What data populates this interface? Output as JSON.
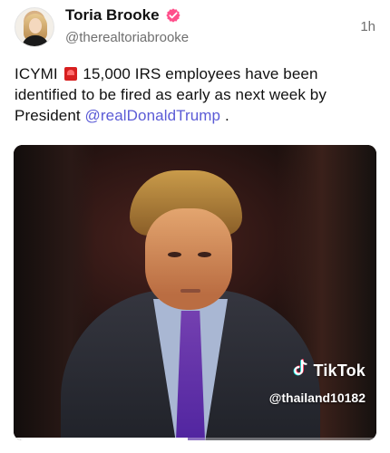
{
  "post": {
    "author_name": "Toria Brooke",
    "handle": "@therealtoriabrooke",
    "time": "1h",
    "text_before_siren": "ICYMI",
    "text_after_siren": "15,000 IRS employees have been identified to be fired as early as next week by President",
    "mention": "@realDonaldTrump",
    "text_end": "."
  },
  "media": {
    "watermark_brand": "TikTok",
    "watermark_handle": "@thailand10182",
    "playback_progress": 0.48
  },
  "icons": {
    "verified": "verified-badge-icon",
    "siren": "police-siren-emoji",
    "tiktok": "tiktok-logo-icon"
  },
  "colors": {
    "verified_badge": "#ff4f8b",
    "mention": "#5b5bd6",
    "siren": "#d71f1f"
  }
}
